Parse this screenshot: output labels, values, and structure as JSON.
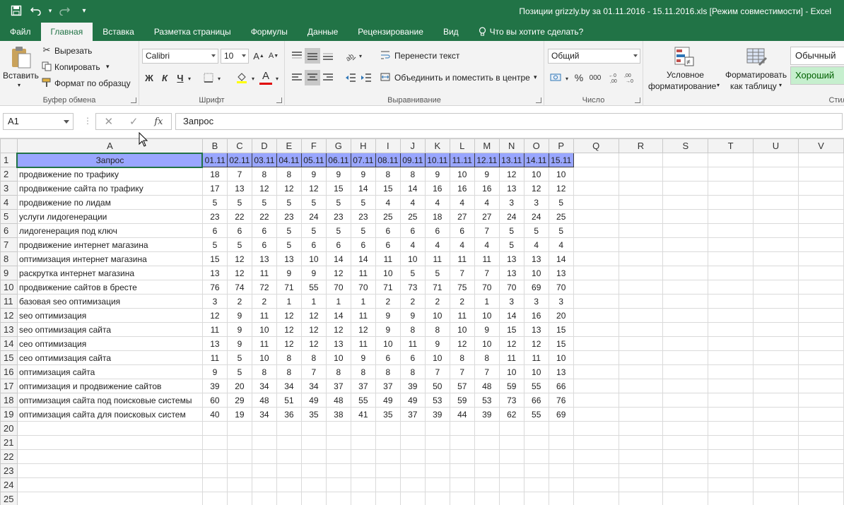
{
  "window": {
    "title": "Позиции grizzly.by за 01.11.2016 - 15.11.2016.xls  [Режим совместимости] - Excel"
  },
  "tabs": [
    "Файл",
    "Главная",
    "Вставка",
    "Разметка страницы",
    "Формулы",
    "Данные",
    "Рецензирование",
    "Вид"
  ],
  "tell_me": "Что вы хотите сделать?",
  "ribbon": {
    "clipboard": {
      "paste": "Вставить",
      "cut": "Вырезать",
      "copy": "Копировать",
      "format_painter": "Формат по образцу",
      "title": "Буфер обмена"
    },
    "font": {
      "name": "Calibri",
      "size": "10",
      "bold": "Ж",
      "italic": "К",
      "underline": "Ч",
      "title": "Шрифт"
    },
    "alignment": {
      "wrap": "Перенести текст",
      "merge": "Объединить и поместить в центре",
      "title": "Выравнивание"
    },
    "number": {
      "format": "Общий",
      "percent": "%",
      "thousands": "000",
      "title": "Число"
    },
    "styles": {
      "conditional": "Условное форматирование",
      "conditional_l1": "Условное",
      "conditional_l2": "форматирование",
      "as_table_l1": "Форматировать",
      "as_table_l2": "как таблицу",
      "normal": "Обычный",
      "good": "Хороший",
      "title": "Стил"
    }
  },
  "formula_bar": {
    "name_box": "A1",
    "fx": "fx",
    "value": "Запрос"
  },
  "sheet": {
    "columns": [
      "A",
      "B",
      "C",
      "D",
      "E",
      "F",
      "G",
      "H",
      "I",
      "J",
      "K",
      "L",
      "M",
      "N",
      "O",
      "P",
      "Q",
      "R",
      "S",
      "T",
      "U",
      "V"
    ],
    "header_row": [
      "Запрос",
      "01.11",
      "02.11",
      "03.11",
      "04.11",
      "05.11",
      "06.11",
      "07.11",
      "08.11",
      "09.11",
      "10.11",
      "11.11",
      "12.11",
      "13.11",
      "14.11",
      "15.11"
    ],
    "rows": [
      [
        "продвижение по трафику",
        "18",
        "7",
        "8",
        "8",
        "9",
        "9",
        "9",
        "8",
        "8",
        "9",
        "10",
        "9",
        "12",
        "10",
        "10"
      ],
      [
        "продвижение сайта по трафику",
        "17",
        "13",
        "12",
        "12",
        "12",
        "15",
        "14",
        "15",
        "14",
        "16",
        "16",
        "16",
        "13",
        "12",
        "12"
      ],
      [
        "продвижение по лидам",
        "5",
        "5",
        "5",
        "5",
        "5",
        "5",
        "5",
        "4",
        "4",
        "4",
        "4",
        "4",
        "3",
        "3",
        "5"
      ],
      [
        "услуги лидогенерации",
        "23",
        "22",
        "22",
        "23",
        "24",
        "23",
        "23",
        "25",
        "25",
        "18",
        "27",
        "27",
        "24",
        "24",
        "25"
      ],
      [
        "лидогенерация под ключ",
        "6",
        "6",
        "6",
        "5",
        "5",
        "5",
        "5",
        "6",
        "6",
        "6",
        "6",
        "7",
        "5",
        "5",
        "5"
      ],
      [
        "продвижение интернет магазина",
        "5",
        "5",
        "6",
        "5",
        "6",
        "6",
        "6",
        "6",
        "4",
        "4",
        "4",
        "4",
        "5",
        "4",
        "4"
      ],
      [
        "оптимизация интернет магазина",
        "15",
        "12",
        "13",
        "13",
        "10",
        "14",
        "14",
        "11",
        "10",
        "11",
        "11",
        "11",
        "13",
        "13",
        "14"
      ],
      [
        "раскрутка интернет магазина",
        "13",
        "12",
        "11",
        "9",
        "9",
        "12",
        "11",
        "10",
        "5",
        "5",
        "7",
        "7",
        "13",
        "10",
        "13"
      ],
      [
        "продвижение сайтов в бресте",
        "76",
        "74",
        "72",
        "71",
        "55",
        "70",
        "70",
        "71",
        "73",
        "71",
        "75",
        "70",
        "70",
        "69",
        "70"
      ],
      [
        "базовая seo оптимизация",
        "3",
        "2",
        "2",
        "1",
        "1",
        "1",
        "1",
        "2",
        "2",
        "2",
        "2",
        "1",
        "3",
        "3",
        "3"
      ],
      [
        "seo оптимизация",
        "12",
        "9",
        "11",
        "12",
        "12",
        "14",
        "11",
        "9",
        "9",
        "10",
        "11",
        "10",
        "14",
        "16",
        "20"
      ],
      [
        "seo оптимизация сайта",
        "11",
        "9",
        "10",
        "12",
        "12",
        "12",
        "12",
        "9",
        "8",
        "8",
        "10",
        "9",
        "15",
        "13",
        "15"
      ],
      [
        "сео оптимизация",
        "13",
        "9",
        "11",
        "12",
        "12",
        "13",
        "11",
        "10",
        "11",
        "9",
        "12",
        "10",
        "12",
        "12",
        "15"
      ],
      [
        "сео оптимизация сайта",
        "11",
        "5",
        "10",
        "8",
        "8",
        "10",
        "9",
        "6",
        "6",
        "10",
        "8",
        "8",
        "11",
        "11",
        "10"
      ],
      [
        "оптимизация сайта",
        "9",
        "5",
        "8",
        "8",
        "7",
        "8",
        "8",
        "8",
        "8",
        "7",
        "7",
        "7",
        "10",
        "10",
        "13"
      ],
      [
        "оптимизация и продвижение сайтов",
        "39",
        "20",
        "34",
        "34",
        "34",
        "37",
        "37",
        "37",
        "39",
        "50",
        "57",
        "48",
        "59",
        "55",
        "66"
      ],
      [
        "оптимизация сайта под поисковые системы",
        "60",
        "29",
        "48",
        "51",
        "49",
        "48",
        "55",
        "49",
        "49",
        "53",
        "59",
        "53",
        "73",
        "66",
        "76"
      ],
      [
        "оптимизация сайта для поисковых систем",
        "40",
        "19",
        "34",
        "36",
        "35",
        "38",
        "41",
        "35",
        "37",
        "39",
        "44",
        "39",
        "62",
        "55",
        "69"
      ]
    ],
    "row_numbers": [
      "1",
      "2",
      "3",
      "4",
      "5",
      "6",
      "7",
      "8",
      "9",
      "10",
      "11",
      "12",
      "13",
      "14",
      "15",
      "16",
      "17",
      "18",
      "19",
      "20",
      "21",
      "22",
      "23",
      "24",
      "25"
    ]
  }
}
